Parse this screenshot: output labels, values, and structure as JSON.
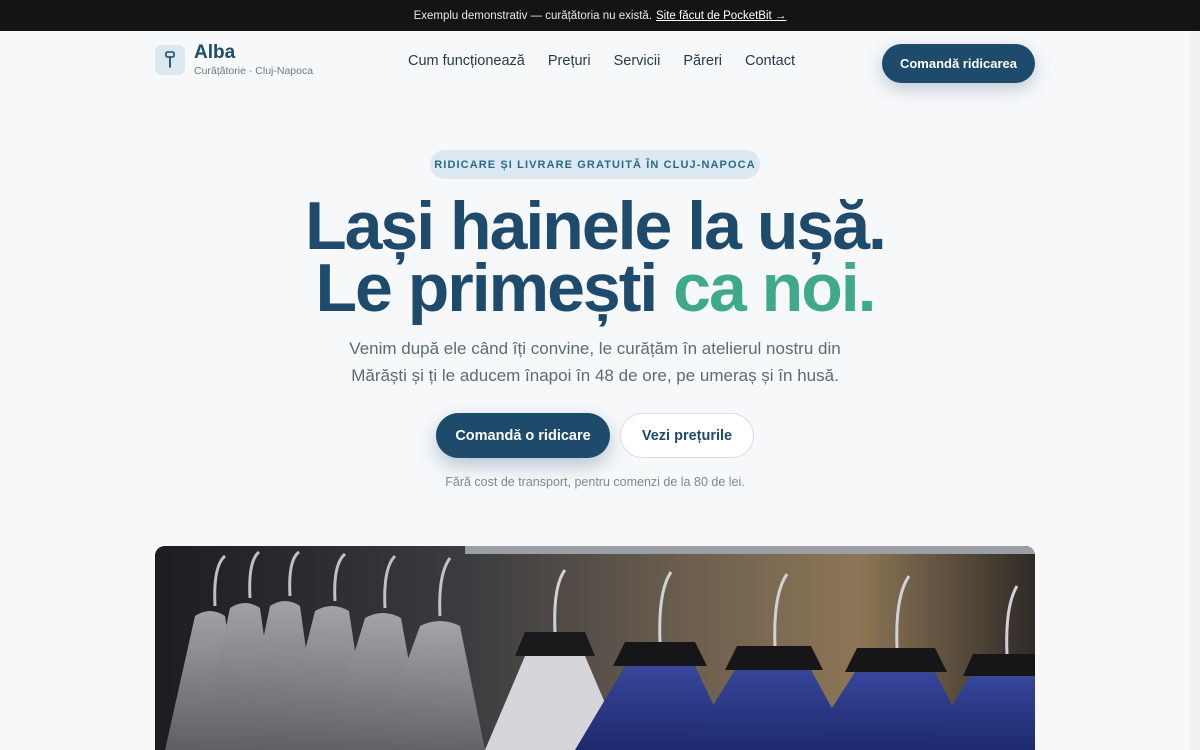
{
  "topbar": {
    "text": "Exemplu demonstrativ — curățătoria nu există.",
    "link": "Site făcut de PocketBit →"
  },
  "brand": {
    "name": "Alba",
    "subtitle": "Curățătorie · Cluj-Napoca",
    "icon": "hanger-tag-icon"
  },
  "nav": {
    "items": [
      "Cum funcționează",
      "Prețuri",
      "Servicii",
      "Păreri",
      "Contact"
    ],
    "cta": "Comandă ridicarea"
  },
  "hero": {
    "badge": "RIDICARE ȘI LIVRARE GRATUITĂ ÎN CLUJ-NAPOCA",
    "line1": "Lași hainele la ușă.",
    "line2_start": "Le primești ",
    "line2_accent": "ca noi.",
    "lead": "Venim după ele când îți convine, le curățăm în atelierul nostru din Mărăști și ți le aducem înapoi în 48 de ore, pe umeraș și în husă.",
    "primary_button": "Comandă o ridicare",
    "secondary_button": "Vezi prețurile",
    "note": "Fără cost de transport, pentru comenzi de la 80 de lei."
  },
  "colors": {
    "primary": "#1e4a6b",
    "accent": "#3fa98a",
    "badge_bg": "#dde9f2",
    "topbar_bg": "#141414"
  },
  "photo": {
    "subject": "suits on hangers on a clothing rack"
  }
}
